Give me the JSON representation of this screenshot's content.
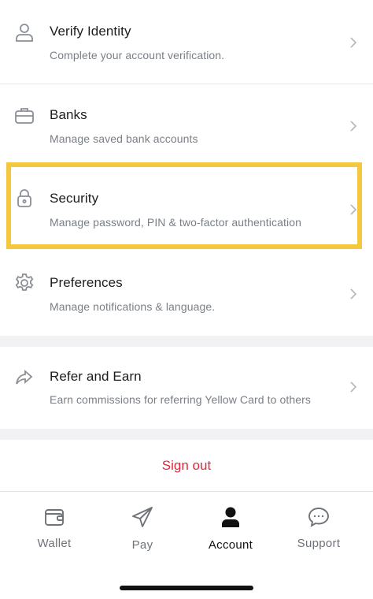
{
  "menu": {
    "items": [
      {
        "title": "Verify Identity",
        "subtitle": "Complete your account verification.",
        "icon": "person-icon"
      },
      {
        "title": "Banks",
        "subtitle": "Manage saved bank accounts",
        "icon": "briefcase-icon"
      },
      {
        "title": "Security",
        "subtitle": "Manage password, PIN & two-factor authentication",
        "icon": "lock-icon"
      },
      {
        "title": "Preferences",
        "subtitle": "Manage notifications & language.",
        "icon": "gear-icon"
      },
      {
        "title": "Refer and Earn",
        "subtitle": "Earn commissions for referring Yellow Card to others",
        "icon": "share-arrow-icon"
      }
    ],
    "highlighted_item": "Security"
  },
  "sign_out": {
    "label": "Sign out",
    "color": "#e1283c"
  },
  "tabbar": {
    "tabs": [
      {
        "label": "Wallet",
        "icon": "wallet-icon"
      },
      {
        "label": "Pay",
        "icon": "paper-plane-icon"
      },
      {
        "label": "Account",
        "icon": "account-person-icon",
        "active": true
      },
      {
        "label": "Support",
        "icon": "chat-bubble-icon"
      }
    ]
  },
  "colors": {
    "highlight": "#f3c73f",
    "accent_text": "#1c1c1e",
    "subtitle": "#7a7f86"
  }
}
